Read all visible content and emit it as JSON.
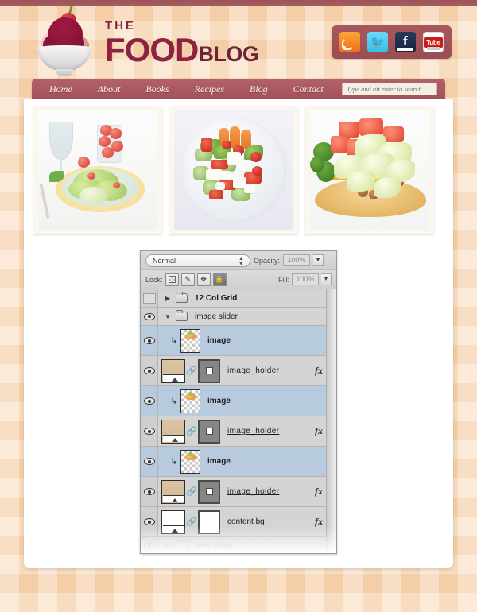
{
  "site": {
    "logo": {
      "the": "THE",
      "food": "FOOD",
      "blog": "BLOG",
      "icon": "ice-cream-sundae-icon"
    },
    "social": [
      {
        "name": "rss-icon",
        "label": "RSS"
      },
      {
        "name": "twitter-icon",
        "label": "Twitter"
      },
      {
        "name": "facebook-icon",
        "label": "f"
      },
      {
        "name": "youtube-icon",
        "label": "Tube"
      }
    ],
    "nav": [
      {
        "label": "Home"
      },
      {
        "label": "About"
      },
      {
        "label": "Books"
      },
      {
        "label": "Recipes"
      },
      {
        "label": "Blog"
      },
      {
        "label": "Contact"
      }
    ],
    "search": {
      "value": "",
      "placeholder": "Type and hit enter to search"
    },
    "slider": [
      {
        "alt": "Green salad with wine glass and cherry tomatoes"
      },
      {
        "alt": "Greek salad with feta, cucumber and carrots on a white plate"
      },
      {
        "alt": "Tostada topped with lettuce, tomato, cheese and beans"
      }
    ],
    "colors": {
      "top_bar": "#9d5459",
      "nav_bar": "#a2515a",
      "brand_maroon": "#8e2340",
      "tablecloth": "#f6d4ae",
      "content_bg": "#ffffff"
    }
  },
  "layers_panel": {
    "blend_mode": {
      "value": "Normal",
      "spinner": "up-down-spinner-icon"
    },
    "opacity": {
      "label": "Opacity:",
      "value": "100%",
      "arrow": "chevron-down-icon"
    },
    "fill": {
      "label": "Fill:",
      "value": "100%",
      "arrow": "chevron-down-icon"
    },
    "lock": {
      "label": "Lock:",
      "buttons": [
        {
          "name": "lock-transparent-pixels-icon",
          "glyph": ""
        },
        {
          "name": "lock-image-pixels-icon",
          "glyph": "✎"
        },
        {
          "name": "lock-position-icon",
          "glyph": "✥"
        },
        {
          "name": "lock-all-icon",
          "glyph": "🔒"
        }
      ]
    },
    "rows": [
      {
        "kind": "folder",
        "name": "12 Col Grid",
        "bold": true,
        "visible": false,
        "expanded": false,
        "selected": false,
        "fx": false,
        "faded": false
      },
      {
        "kind": "folder",
        "name": "image slider",
        "bold": false,
        "visible": true,
        "expanded": true,
        "selected": false,
        "fx": false,
        "faded": false
      },
      {
        "kind": "layer",
        "name": "image",
        "bold": true,
        "underline": false,
        "visible": true,
        "selected": true,
        "clipped": true,
        "thumb": "checker",
        "mask": false,
        "linked": false,
        "fx": false,
        "faded": false
      },
      {
        "kind": "layer",
        "name": "image_holder",
        "bold": false,
        "underline": true,
        "visible": true,
        "selected": false,
        "clipped": false,
        "thumb": "tan",
        "mask": true,
        "linked": true,
        "fx": true,
        "faded": false
      },
      {
        "kind": "layer",
        "name": "image",
        "bold": true,
        "underline": false,
        "visible": true,
        "selected": true,
        "clipped": true,
        "thumb": "checker",
        "mask": false,
        "linked": false,
        "fx": false,
        "faded": false
      },
      {
        "kind": "layer",
        "name": "image_holder",
        "bold": false,
        "underline": true,
        "visible": true,
        "selected": false,
        "clipped": false,
        "thumb": "tan",
        "mask": true,
        "linked": true,
        "fx": true,
        "faded": false
      },
      {
        "kind": "layer",
        "name": "image",
        "bold": true,
        "underline": false,
        "visible": true,
        "selected": true,
        "clipped": true,
        "thumb": "checker",
        "mask": false,
        "linked": false,
        "fx": false,
        "faded": false
      },
      {
        "kind": "layer",
        "name": "image_holder",
        "bold": false,
        "underline": true,
        "visible": true,
        "selected": false,
        "clipped": false,
        "thumb": "tan",
        "mask": true,
        "linked": true,
        "fx": true,
        "faded": false
      },
      {
        "kind": "layer",
        "name": "content bg",
        "bold": false,
        "underline": false,
        "visible": true,
        "selected": false,
        "clipped": false,
        "thumb": "white",
        "mask": "white",
        "linked": true,
        "fx": true,
        "faded": false
      },
      {
        "kind": "folder",
        "name": "search bar",
        "bold": false,
        "visible": true,
        "expanded": false,
        "selected": false,
        "fx": false,
        "faded": true
      }
    ]
  }
}
